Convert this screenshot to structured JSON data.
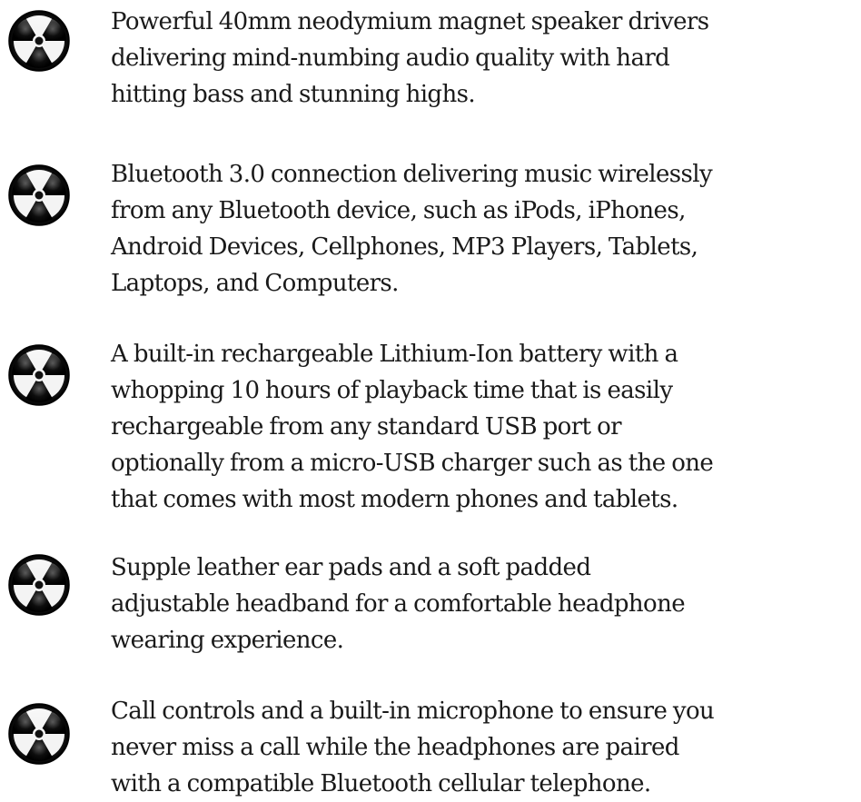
{
  "bullet_icon": "radiation-trefoil-icon",
  "colors": {
    "text": "#1a1a1a",
    "icon_dark": "#111111",
    "icon_light": "#f2f2f2"
  },
  "features": [
    {
      "text": "Powerful 40mm neodymium magnet speaker drivers\ndelivering mind-numbing audio quality with hard\nhitting bass and stunning highs."
    },
    {
      "text": "Bluetooth 3.0 connection delivering music wirelessly\nfrom any Bluetooth device, such as iPods, iPhones,\nAndroid Devices, Cellphones, MP3 Players, Tablets,\nLaptops, and Computers."
    },
    {
      "text": "A built-in rechargeable Lithium-Ion battery with a\nwhopping 10 hours of playback time that is easily\nrechargeable from any standard USB port or\noptionally from a micro-USB charger such as the one\nthat comes with most modern phones and tablets."
    },
    {
      "text": "Supple leather ear pads and a soft padded\nadjustable headband for a comfortable headphone\nwearing experience."
    },
    {
      "text": "Call controls and a built-in microphone to ensure you\nnever miss a call while the headphones are paired\nwith a compatible Bluetooth cellular telephone."
    }
  ]
}
